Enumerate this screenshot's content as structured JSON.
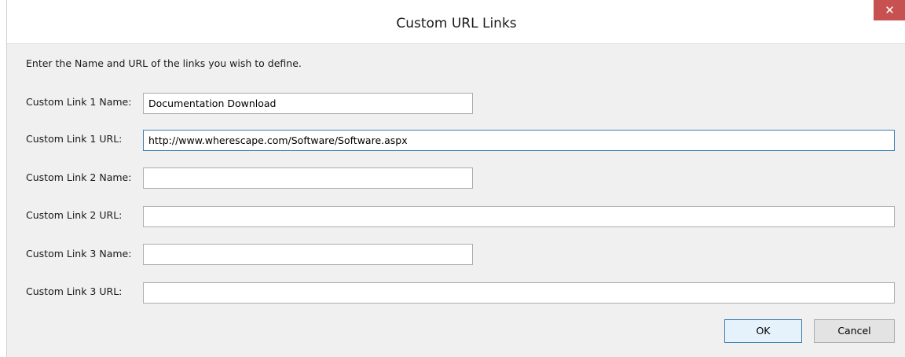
{
  "dialog": {
    "title": "Custom URL Links",
    "close_symbol": "✕",
    "instructions": "Enter the Name and URL of the links you wish to define."
  },
  "fields": [
    {
      "label": "Custom Link 1 Name:",
      "value": "Documentation Download"
    },
    {
      "label": "Custom Link 1 URL:",
      "value": "http://www.wherescape.com/Software/Software.aspx"
    },
    {
      "label": "Custom Link 2 Name:",
      "value": ""
    },
    {
      "label": "Custom Link 2 URL:",
      "value": ""
    },
    {
      "label": "Custom Link 3 Name:",
      "value": ""
    },
    {
      "label": "Custom Link 3 URL:",
      "value": ""
    }
  ],
  "buttons": {
    "ok_label": "OK",
    "cancel_label": "Cancel"
  },
  "colors": {
    "close_button": "#c75050",
    "focus_border": "#3c7fb1",
    "dialog_background": "#f0f0f0"
  },
  "icons": {
    "close": "close-icon"
  }
}
